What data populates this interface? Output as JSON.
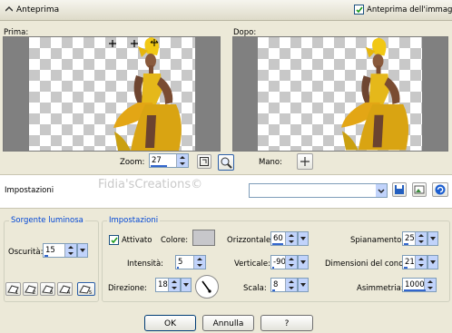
{
  "header": {
    "title": "Anteprima",
    "preview_label": "Anteprima dell'immagine",
    "preview_checked": true
  },
  "panes": {
    "before_label": "Prima:",
    "after_label": "Dopo:"
  },
  "zoom": {
    "label": "Zoom:",
    "value": "27"
  },
  "hand": {
    "label": "Mano:"
  },
  "presets": {
    "label": "Impostazioni",
    "watermark": "Fidia'sCreations©",
    "value": ""
  },
  "light_source": {
    "legend": "Sorgente luminosa",
    "darkness_label": "Oscurità:",
    "darkness_value": "15"
  },
  "settings": {
    "legend": "Impostazioni",
    "active_label": "Attivato",
    "active_checked": true,
    "color_label": "Colore:",
    "color_value": "#c7c7cb",
    "intensity_label": "Intensità:",
    "intensity_value": "5",
    "direction_label": "Direzione:",
    "direction_value": "18",
    "horizontal_label": "Orizzontale:",
    "horizontal_value": "60",
    "vertical_label": "Verticale:",
    "vertical_value": "-90",
    "scale_label": "Scala:",
    "scale_value": "8",
    "flatten_label": "Spianamento:",
    "flatten_value": "25",
    "cone_label": "Dimensioni del cono:",
    "cone_value": "21",
    "asymmetry_label": "Asimmetria:",
    "asymmetry_value": "1000"
  },
  "footer": {
    "ok": "OK",
    "cancel": "Annulla",
    "help": "?"
  },
  "colors": {
    "accent": "#0046d5",
    "figure_dress": "#e5b81a",
    "pane_bg": "#808080"
  }
}
